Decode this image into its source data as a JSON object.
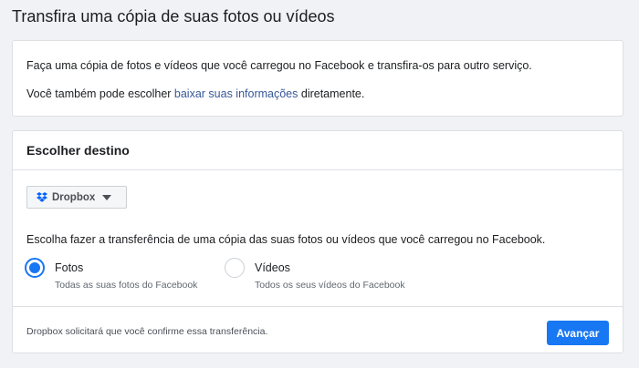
{
  "page": {
    "title": "Transfira uma cópia de suas fotos ou vídeos"
  },
  "intro": {
    "line1": "Faça uma cópia de fotos e vídeos que você carregou no Facebook e transfira-os para outro serviço.",
    "line2_prefix": "Você também pode escolher ",
    "line2_link": "baixar suas informações",
    "line2_suffix": " diretamente."
  },
  "destination": {
    "header": "Escolher destino",
    "dropdown": {
      "icon": "dropbox-icon",
      "selected": "Dropbox"
    },
    "instruction": "Escolha fazer a transferência de uma cópia das suas fotos ou vídeos que você carregou no Facebook.",
    "options": [
      {
        "label": "Fotos",
        "sublabel": "Todas as suas fotos do Facebook",
        "selected": true
      },
      {
        "label": "Vídeos",
        "sublabel": "Todos os seus vídeos do Facebook",
        "selected": false
      }
    ],
    "footer_note": "Dropbox solicitará que você confirme essa transferência.",
    "next_button": "Avançar"
  },
  "colors": {
    "accent": "#1877f2",
    "link": "#385898",
    "background": "#f0f2f5"
  }
}
